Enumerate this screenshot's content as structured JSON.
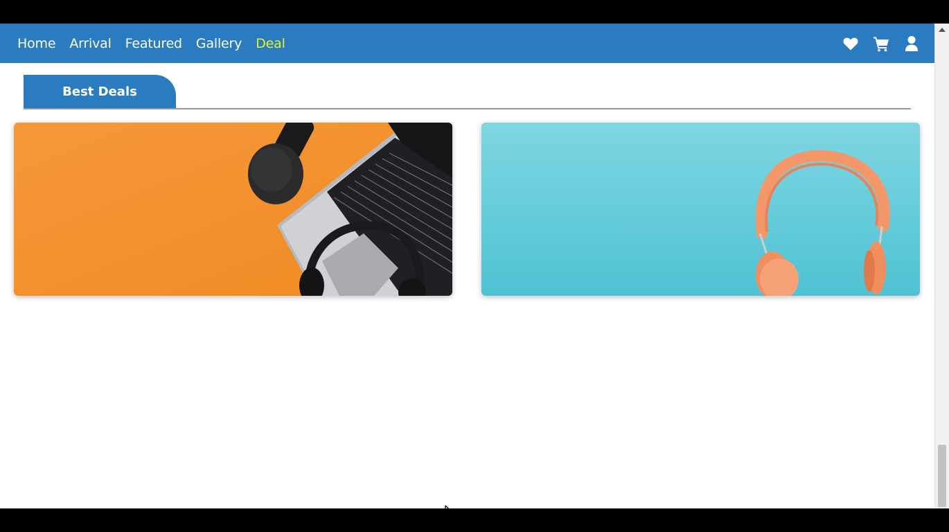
{
  "nav": {
    "links": [
      "Home",
      "Arrival",
      "Featured",
      "Gallery",
      "Deal"
    ],
    "active_link": "Deal",
    "icons": [
      "heart-icon",
      "cart-icon",
      "user-icon"
    ]
  },
  "section": {
    "title": "Best Deals"
  },
  "deals": [
    {
      "image": "laptop-microphone-headphones-on-orange",
      "background": "#f4912f"
    },
    {
      "image": "orange-headphones-on-teal",
      "background": "#5cc9d9"
    }
  ],
  "colors": {
    "primary": "#2a7bc0",
    "active_link": "#e6ef2c"
  }
}
